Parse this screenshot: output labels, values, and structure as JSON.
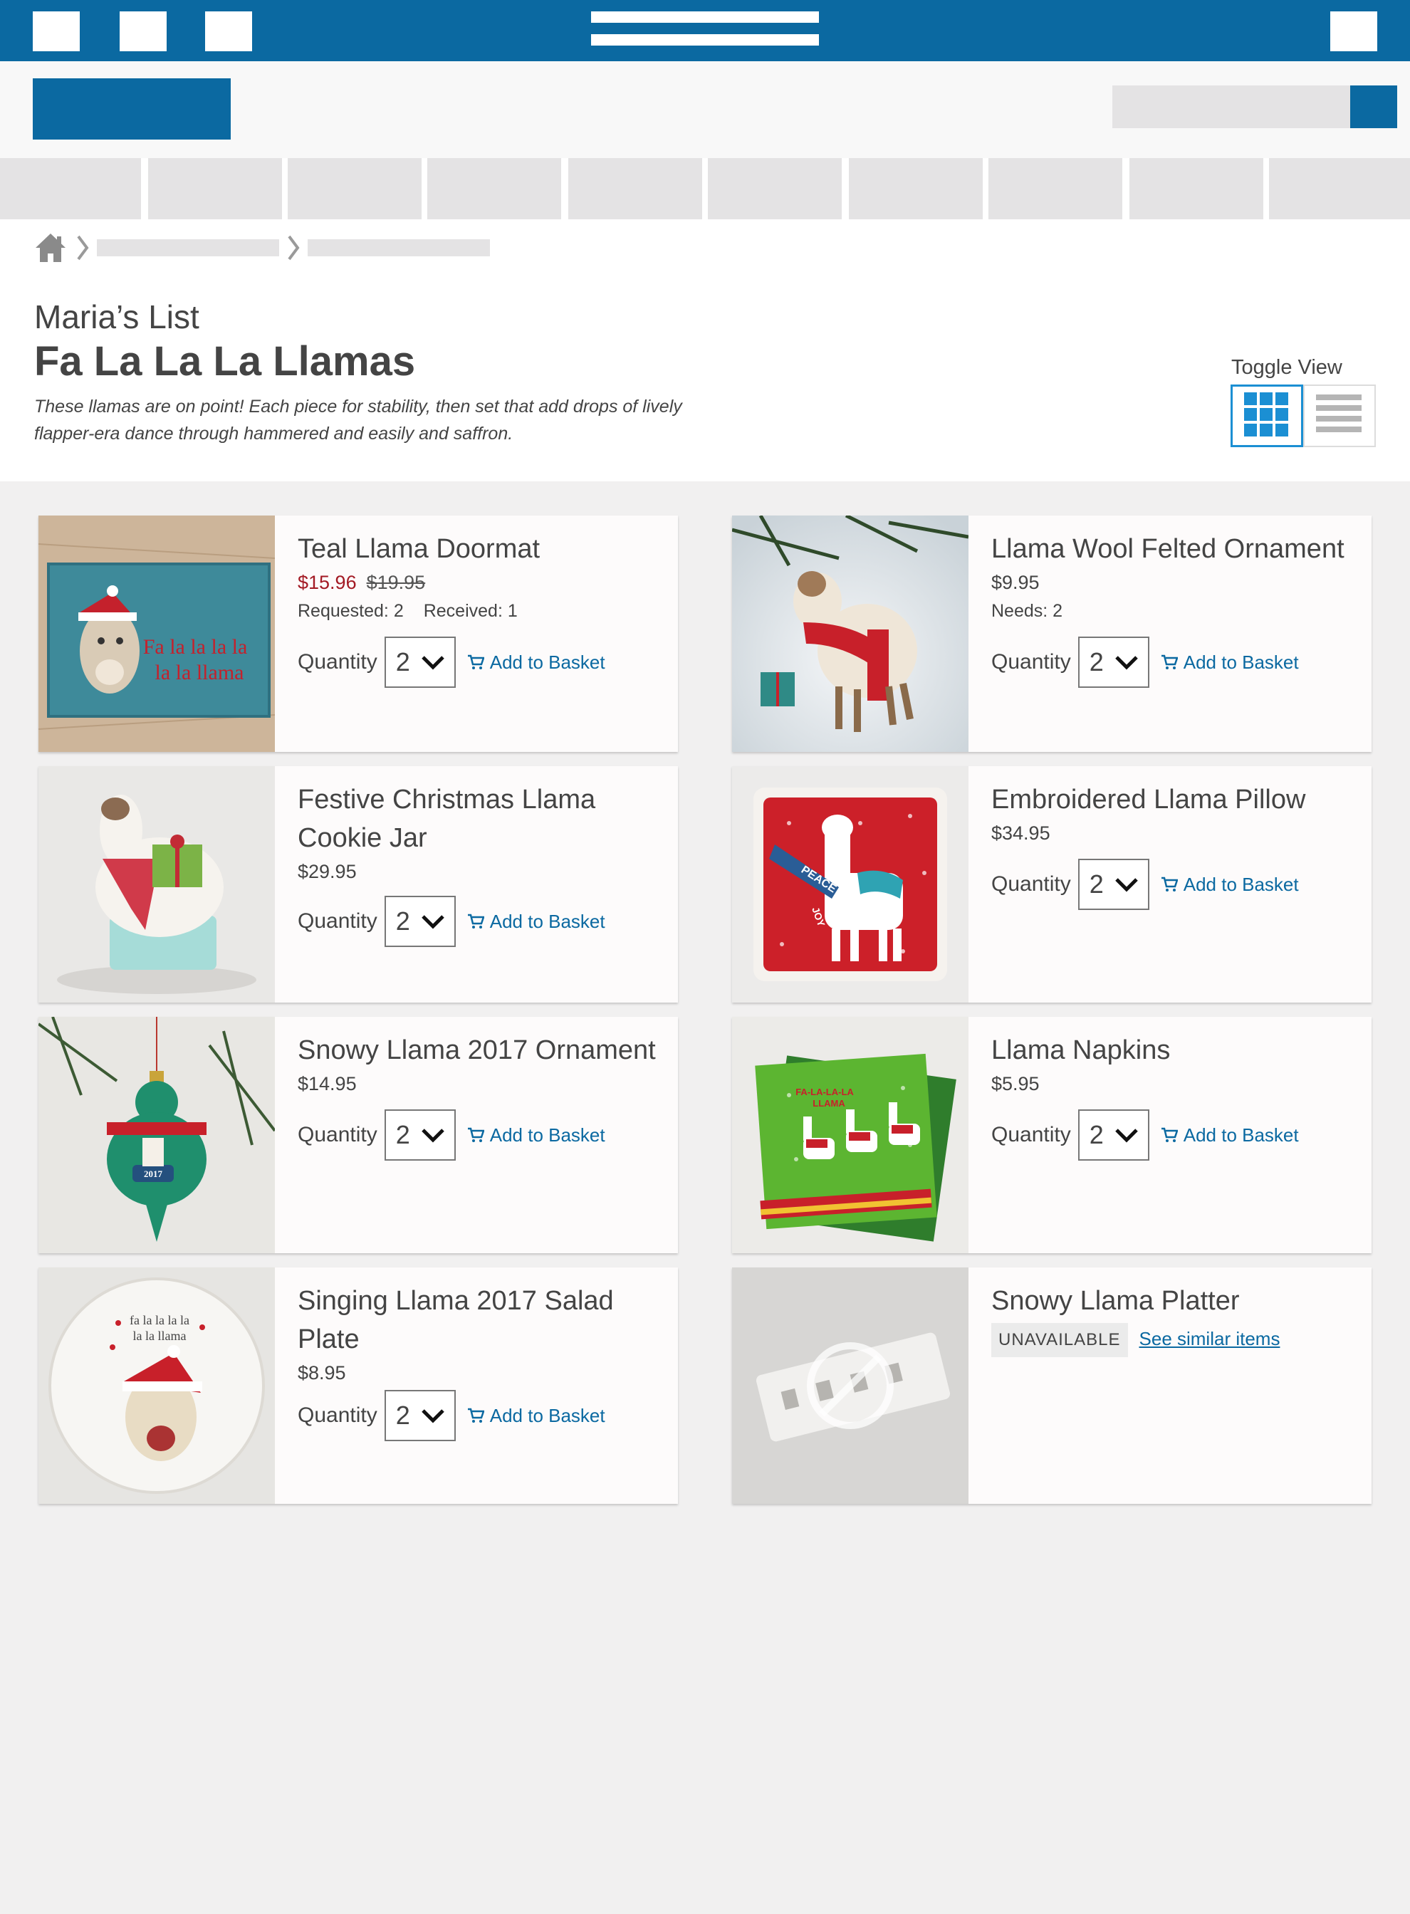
{
  "search": {
    "placeholder": ""
  },
  "list": {
    "owner": "Maria’s List",
    "title": "Fa La La La Llamas",
    "description": "These llamas are on point! Each piece for stability, then set that add drops of lively flapper-era dance through hammered and easily and saffron."
  },
  "toggle": {
    "label": "Toggle View",
    "active": "grid"
  },
  "labels": {
    "quantity": "Quantity",
    "add_to_basket": "Add to Basket",
    "unavailable": "UNAVAILABLE",
    "see_similar": "See similar items"
  },
  "colors": {
    "brand": "#0b69a1",
    "sale": "#a31a24",
    "link": "#0b69a1",
    "toggle_active": "#1b8fd3"
  },
  "products": [
    {
      "name": "Teal Llama Doormat",
      "price": "$15.96",
      "was": "$19.95",
      "requested": "Requested: 2",
      "received": "Received: 1",
      "quantity": "2",
      "image_text": "Fa la la la la\nla la llama"
    },
    {
      "name": "Llama Wool Felted Ornament",
      "price": "$9.95",
      "needs": "Needs: 2",
      "quantity": "2"
    },
    {
      "name": "Festive Christmas Llama Cookie Jar",
      "price": "$29.95",
      "quantity": "2"
    },
    {
      "name": "Embroidered Llama Pillow",
      "price": "$34.95",
      "quantity": "2",
      "image_text": [
        "PEACE",
        "JOY"
      ]
    },
    {
      "name": "Snowy Llama 2017 Ornament",
      "price": "$14.95",
      "quantity": "2",
      "image_text": "2017"
    },
    {
      "name": "Llama Napkins",
      "price": "$5.95",
      "quantity": "2",
      "image_text": "FA-LA-LA-LA LLAMA"
    },
    {
      "name": "Singing Llama 2017 Salad Plate",
      "price": "$8.95",
      "quantity": "2",
      "image_text": "fa la la la la\nla la llama"
    },
    {
      "name": "Snowy Llama Platter",
      "available": false
    }
  ]
}
